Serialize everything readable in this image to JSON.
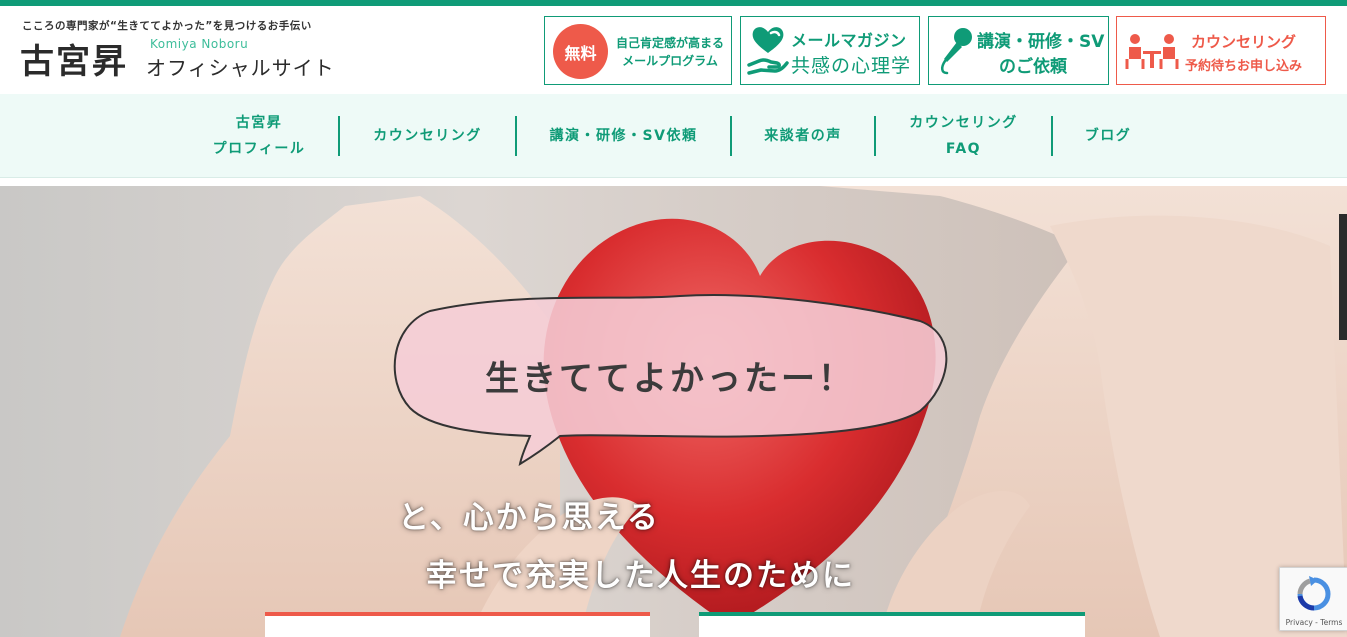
{
  "header": {
    "tagline": "こころの専門家が“生きててよかった”を見つけるお手伝い",
    "site_name": "古宮昇",
    "site_name_roman": "Komiya Noboru",
    "site_subtitle": "オフィシャルサイト",
    "buttons": {
      "free_badge": "無料",
      "free_line1": "自己肯定感が高まる",
      "free_line2": "メールプログラム",
      "mail_line1": "メールマガジン",
      "mail_line2": "共感の心理学",
      "talk_line1": "講演・研修・SV",
      "talk_line2": "のご依頼",
      "counsel_line1": "カウンセリング",
      "counsel_line2": "予約待ちお申し込み"
    },
    "icons": {
      "mail": "heart-hand-icon",
      "talk": "microphone-icon",
      "counsel": "counseling-icon"
    }
  },
  "nav": {
    "items": [
      {
        "line1": "古宮昇",
        "line2": "プロフィール"
      },
      {
        "line1": "カウンセリング",
        "line2": ""
      },
      {
        "line1": "講演・研修・SV依頼",
        "line2": ""
      },
      {
        "line1": "来談者の声",
        "line2": ""
      },
      {
        "line1": "カウンセリング",
        "line2": "FAQ"
      },
      {
        "line1": "ブログ",
        "line2": ""
      }
    ]
  },
  "hero": {
    "bubble_text": "生きててよかったー！",
    "tagline1": "と、心から思える",
    "tagline2": "幸せで充実した人生のために"
  },
  "recaptcha": {
    "terms": "Privacy - Terms"
  },
  "colors": {
    "brand_green": "#0f9b77",
    "accent_red": "#ee5a4a",
    "nav_bg": "#eefaf7"
  }
}
